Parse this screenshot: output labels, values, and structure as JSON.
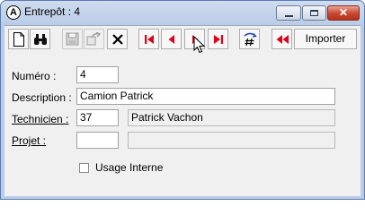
{
  "window": {
    "title": "Entrepôt : 4",
    "app_icon_letter": "A",
    "minimize_icon": "minimize-icon",
    "maximize_icon": "maximize-icon",
    "close_icon": "close-icon",
    "close_glyph": "✕"
  },
  "toolbar": {
    "buttons": [
      {
        "icon": "new-document-icon",
        "enabled": true
      },
      {
        "icon": "binoculars-search-icon",
        "enabled": true
      },
      {
        "icon": "save-disk-icon",
        "enabled": false
      },
      {
        "icon": "copy-export-icon",
        "enabled": false
      },
      {
        "icon": "delete-x-icon",
        "enabled": true
      },
      {
        "icon": "first-record-icon",
        "enabled": true
      },
      {
        "icon": "previous-record-icon",
        "enabled": true
      },
      {
        "icon": "next-record-icon",
        "enabled": true
      },
      {
        "icon": "last-record-icon",
        "enabled": true
      },
      {
        "icon": "renumber-hash-icon",
        "enabled": true
      },
      {
        "icon": "rewind-icon",
        "enabled": true
      }
    ],
    "import_label": "Importer",
    "accent_color": "#e0001b"
  },
  "form": {
    "numero_label": "Numéro :",
    "numero_value": "4",
    "description_label": "Description :",
    "description_value": "Camion Patrick",
    "technicien_label": "Technicien :",
    "technicien_code": "37",
    "technicien_name": "Patrick Vachon",
    "projet_label": "Projet :",
    "projet_code": "",
    "projet_name": "",
    "usage_interne_label": "Usage Interne",
    "usage_interne_checked": false
  }
}
